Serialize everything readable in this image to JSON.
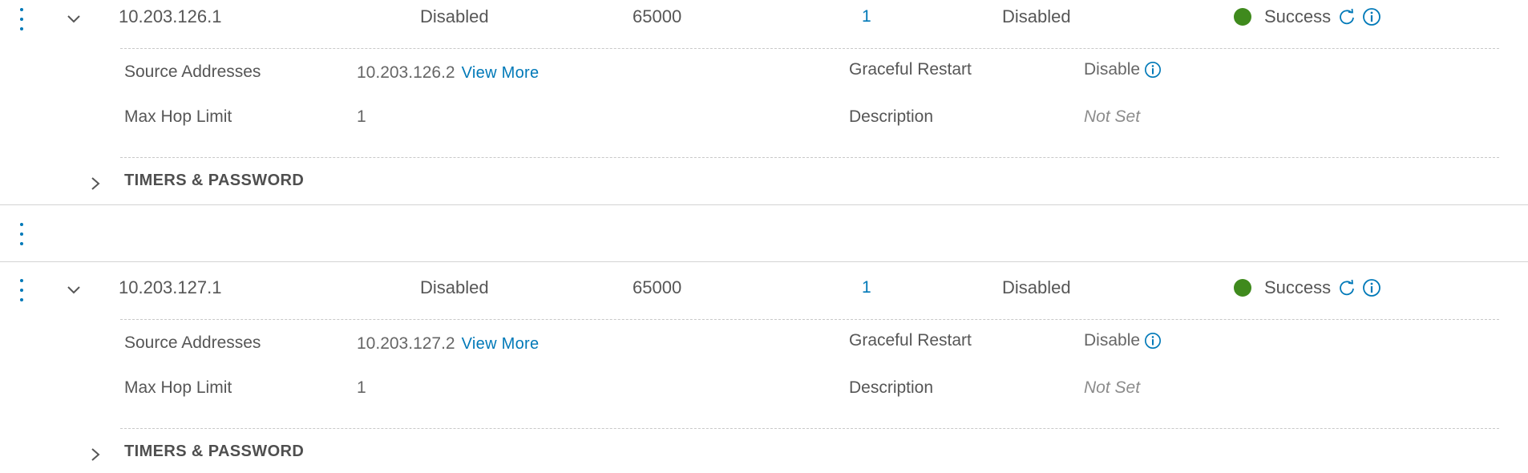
{
  "rows": [
    {
      "ip": "10.203.126.1",
      "col2": "Disabled",
      "asn": "65000",
      "count": "1",
      "col5": "Disabled",
      "status": "Success",
      "source_addresses_label": "Source Addresses",
      "source_address": "10.203.126.2",
      "view_more": "View More",
      "graceful_restart_label": "Graceful Restart",
      "graceful_restart_value": "Disable",
      "max_hop_label": "Max Hop Limit",
      "max_hop_value": "1",
      "description_label": "Description",
      "description_value": "Not Set",
      "section_title": "TIMERS & PASSWORD"
    },
    {
      "ip": "10.203.127.1",
      "col2": "Disabled",
      "asn": "65000",
      "count": "1",
      "col5": "Disabled",
      "status": "Success",
      "source_addresses_label": "Source Addresses",
      "source_address": "10.203.127.2",
      "view_more": "View More",
      "graceful_restart_label": "Graceful Restart",
      "graceful_restart_value": "Disable",
      "max_hop_label": "Max Hop Limit",
      "max_hop_value": "1",
      "description_label": "Description",
      "description_value": "Not Set",
      "section_title": "TIMERS & PASSWORD"
    }
  ],
  "colors": {
    "accent": "#0079b8",
    "success": "#3f8a1d"
  },
  "icons": {
    "row_menu": "vertical-ellipsis-icon",
    "expanded": "chevron-down-icon",
    "collapsed": "chevron-right-icon",
    "refresh": "refresh-icon",
    "info": "info-circle-icon"
  }
}
